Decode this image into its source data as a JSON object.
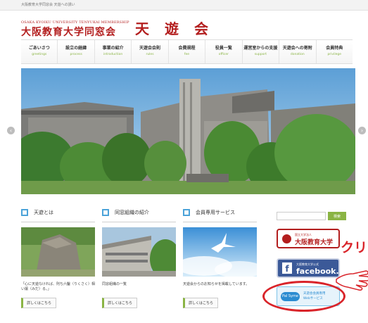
{
  "topbar": {
    "text": "大阪教育大学同窓会 天遊への誘い"
  },
  "brand": {
    "english": "OSAKA KYOIKU UNIVERSITY TENYUKAI MEMBERSHIP",
    "japanese": "大阪教育大学同窓会",
    "name": "天遊会"
  },
  "nav": [
    {
      "jp": "ごあいさつ",
      "en": "greetings"
    },
    {
      "jp": "設立の経緯",
      "en": "process"
    },
    {
      "jp": "事業の紹介",
      "en": "introduction"
    },
    {
      "jp": "天遊会会則",
      "en": "rules"
    },
    {
      "jp": "会費規程",
      "en": "fee"
    },
    {
      "jp": "役員一覧",
      "en": "officer"
    },
    {
      "jp": "運営室からの支援",
      "en": "support"
    },
    {
      "jp": "天遊会への寄附",
      "en": "donation"
    },
    {
      "jp": "会員特典",
      "en": "privilege"
    }
  ],
  "slider": {
    "prev": "‹",
    "next": "›"
  },
  "columns": [
    {
      "title": "天遊とは",
      "text": "「心に天遊なければ、則ち六鑿（りくさく）相い攘（みだ）る。」",
      "button": "詳しくはこちら"
    },
    {
      "title": "同窓組織の紹介",
      "text": "同窓組織の一覧",
      "button": "詳しくはこちら"
    },
    {
      "title": "会員専用サービス",
      "text": "天遊会からのお知らせを掲載しています。",
      "button": "詳しくはこちら"
    }
  ],
  "sidebar": {
    "search_button": "検索",
    "univ_banner": {
      "small": "国立大学法人",
      "name": "大阪教育大学"
    },
    "fb_banner": {
      "f": "f",
      "small": "大阪教育大学公式",
      "name": "facebook."
    },
    "pal_banner": {
      "pill": "Pal Syme",
      "line1": "天遊会会員専用",
      "line2": "Webサービス"
    }
  },
  "callout": {
    "text": "クリ"
  }
}
